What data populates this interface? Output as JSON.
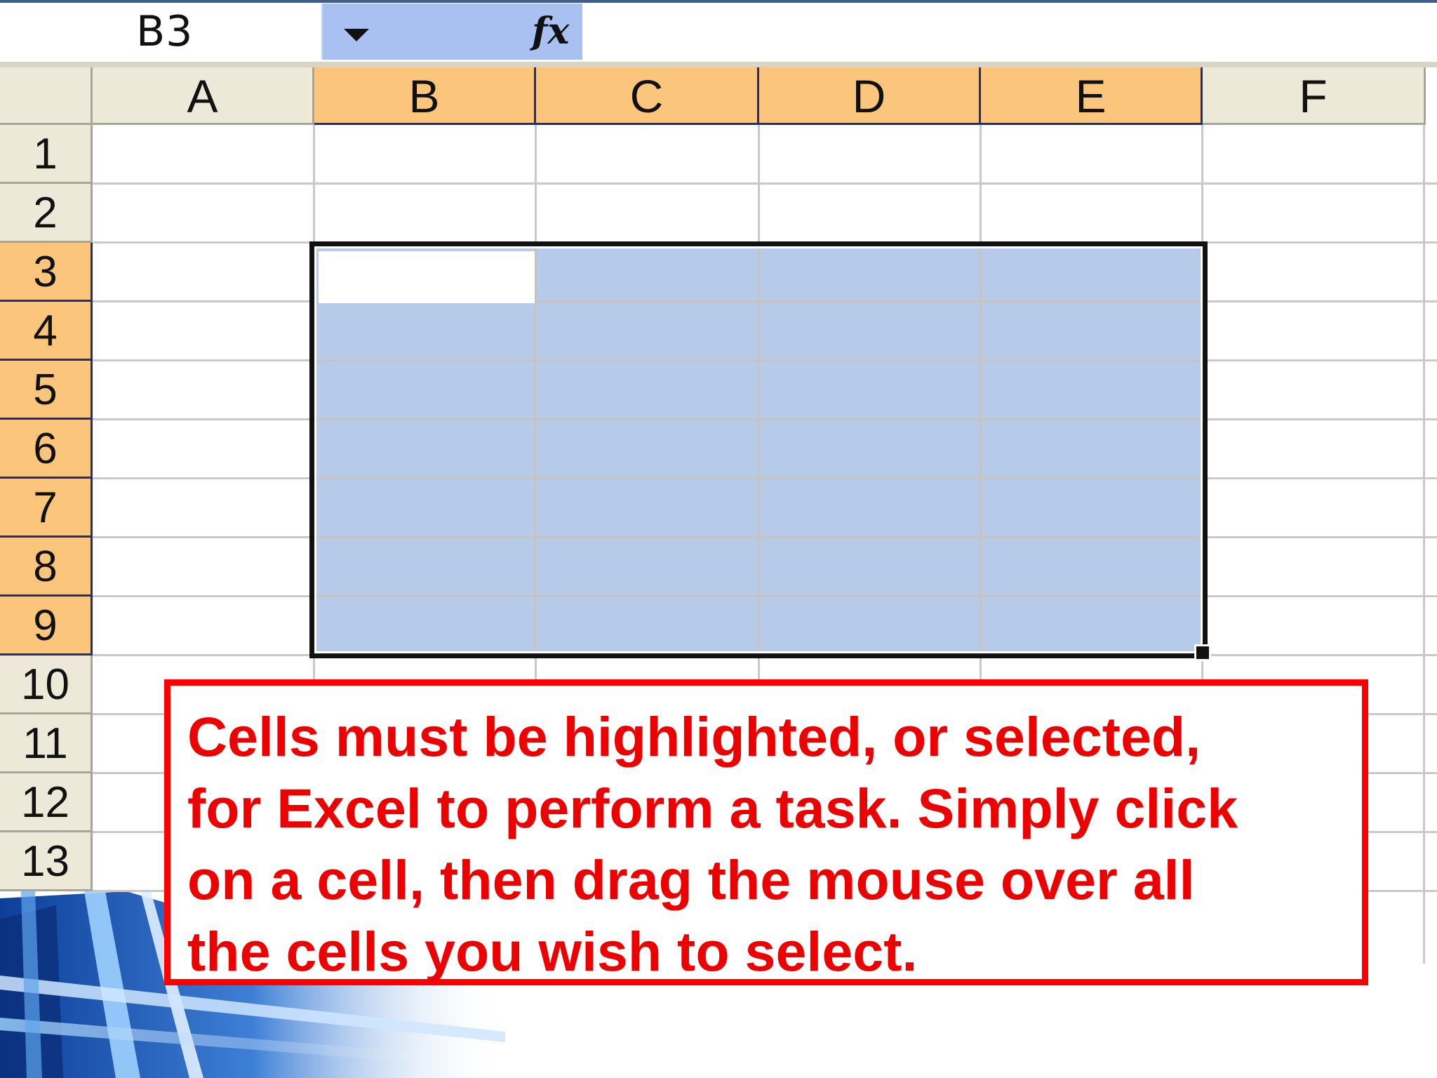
{
  "formula_bar": {
    "name_box_value": "B3",
    "fx_label": "fx"
  },
  "sheet": {
    "columns": [
      {
        "label": "A",
        "selected": false
      },
      {
        "label": "B",
        "selected": true
      },
      {
        "label": "C",
        "selected": true
      },
      {
        "label": "D",
        "selected": true
      },
      {
        "label": "E",
        "selected": true
      },
      {
        "label": "F",
        "selected": false
      }
    ],
    "rows": [
      {
        "label": "1",
        "selected": false
      },
      {
        "label": "2",
        "selected": false
      },
      {
        "label": "3",
        "selected": true
      },
      {
        "label": "4",
        "selected": true
      },
      {
        "label": "5",
        "selected": true
      },
      {
        "label": "6",
        "selected": true
      },
      {
        "label": "7",
        "selected": true
      },
      {
        "label": "8",
        "selected": true
      },
      {
        "label": "9",
        "selected": true
      },
      {
        "label": "10",
        "selected": false
      },
      {
        "label": "11",
        "selected": false
      },
      {
        "label": "12",
        "selected": false
      },
      {
        "label": "13",
        "selected": false
      }
    ],
    "selected_range": "B3:E9",
    "active_cell": "B3"
  },
  "callout": {
    "text": "Cells must be highlighted, or selected,\nfor Excel to perform a task. Simply click\non a cell, then drag the mouse over all\nthe cells you wish to select."
  },
  "colors": {
    "selection_fill": "#b6cae9",
    "header_selected": "#fcc57c",
    "header_normal": "#ece9d8",
    "callout_red": "#ee0000",
    "formula_bar_blue": "#a8c1f0"
  }
}
